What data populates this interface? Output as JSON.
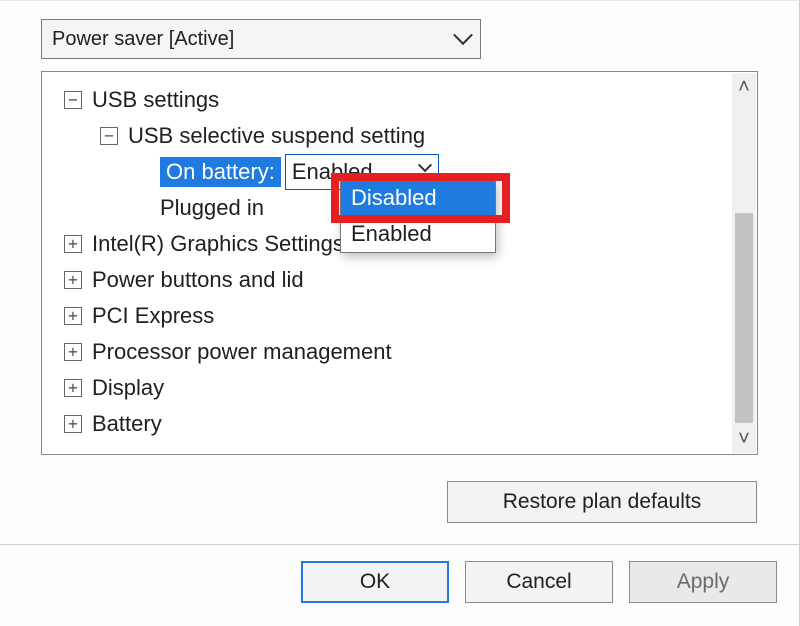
{
  "plan_selector": {
    "value": "Power saver [Active]"
  },
  "tree": {
    "usb_settings": {
      "label": "USB settings",
      "expanded": true,
      "child": {
        "label": "USB selective suspend setting",
        "expanded": true,
        "on_battery": {
          "label": "On battery:",
          "value": "Enabled"
        },
        "plugged_in": {
          "label": "Plugged in",
          "value_hidden_behind_popup": true
        }
      }
    },
    "intel_graphics": {
      "label": "Intel(R) Graphics Settings",
      "expanded": false
    },
    "power_buttons": {
      "label": "Power buttons and lid",
      "expanded": false
    },
    "pci_express": {
      "label": "PCI Express",
      "expanded": false
    },
    "processor_pm": {
      "label": "Processor power management",
      "expanded": false
    },
    "display": {
      "label": "Display",
      "expanded": false
    },
    "battery": {
      "label": "Battery",
      "expanded": false
    }
  },
  "dropdown": {
    "options": {
      "disabled": "Disabled",
      "enabled": "Enabled"
    },
    "highlighted": "disabled"
  },
  "buttons": {
    "restore": "Restore plan defaults",
    "ok": "OK",
    "cancel": "Cancel",
    "apply": "Apply"
  },
  "glyphs": {
    "expanded": "⊟",
    "collapsed": "⊞"
  }
}
